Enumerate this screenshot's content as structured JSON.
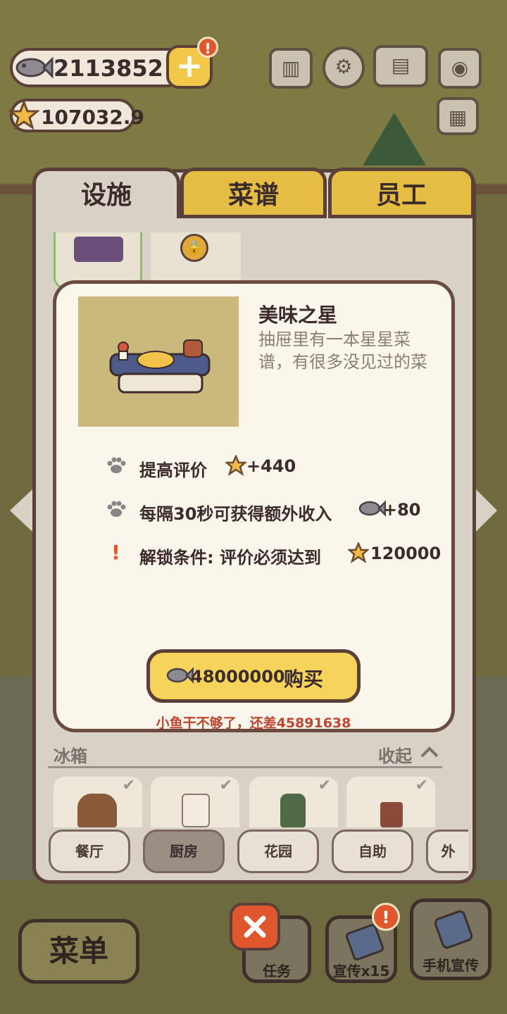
{
  "currency": {
    "fish_count": "2113852",
    "star_count": "107032.9",
    "plus_symbol": "+",
    "badge_symbol": "!"
  },
  "tabs": [
    {
      "label": "设施",
      "active": true
    },
    {
      "label": "菜谱",
      "active": false
    },
    {
      "label": "员工",
      "active": false
    }
  ],
  "item": {
    "name": "美味之星",
    "description": "抽屉里有一本星星菜谱，有很多没见过的菜",
    "effects": [
      {
        "label": "提高评价",
        "value": "+440",
        "icon": "star-icon"
      },
      {
        "label": "每隔30秒可获得额外收入",
        "value": "+80",
        "icon": "fish-icon"
      }
    ],
    "unlock": {
      "label": "解锁条件: 评价必须达到",
      "value": "120000",
      "icon": "star-icon"
    },
    "price": "48000000",
    "buy_label": "购买",
    "warning": "小鱼干不够了，还差45891638"
  },
  "section": {
    "label": "冰箱",
    "collapse_label": "收起"
  },
  "categories": [
    "餐厅",
    "厨房",
    "花园",
    "自助",
    "外"
  ],
  "active_category": "厨房",
  "bottom": {
    "menu_label": "菜单",
    "tasks_label": "任务",
    "promo_label": "宣传x15",
    "phone_promo_label": "手机宣传"
  },
  "colors": {
    "accent_yellow": "#f6d45c",
    "tab_yellow": "#e5bd42",
    "outline_brown": "#5a4038",
    "warning_red": "#c0452e",
    "badge_orange": "#e0572e"
  }
}
